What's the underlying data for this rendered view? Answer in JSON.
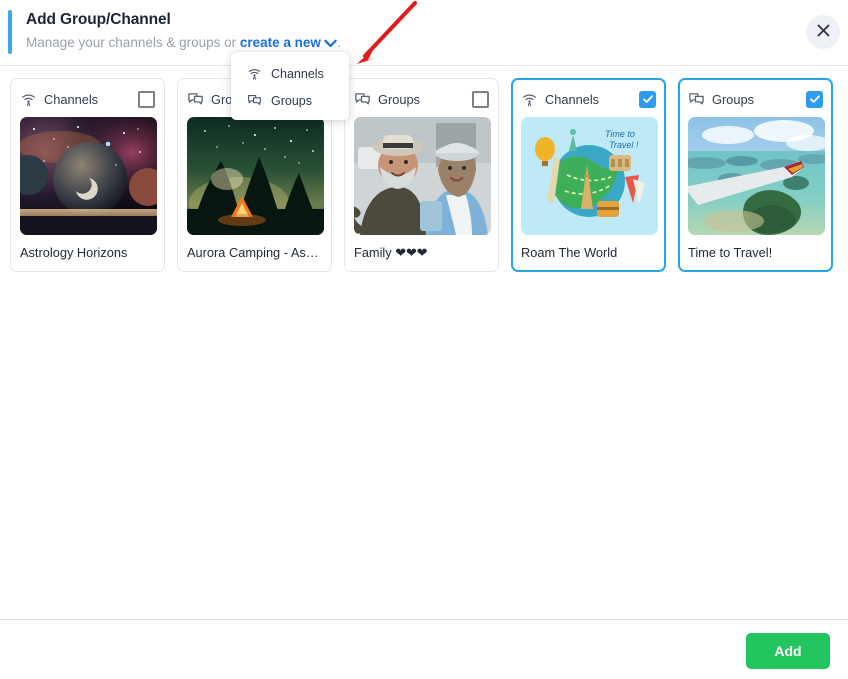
{
  "header": {
    "title": "Add Group/Channel",
    "subtitle_prefix": "Manage your channels & groups or ",
    "create_link": "create a new",
    "subtitle_suffix": ".",
    "close_icon": "close-icon",
    "accent_color": "#3ba7e8"
  },
  "dropdown": {
    "items": [
      {
        "label": "Channels",
        "icon": "broadcast-icon"
      },
      {
        "label": "Groups",
        "icon": "chat-bubbles-icon"
      }
    ]
  },
  "annotation": {
    "type": "arrow",
    "color": "#e01b1b"
  },
  "cards": [
    {
      "type_label": "Channels",
      "type_icon": "broadcast-icon",
      "name": "Astrology Horizons",
      "selected": false,
      "thumb": "space-planets-nebula"
    },
    {
      "type_label": "Groups",
      "type_icon": "chat-bubbles-icon",
      "name": "Aurora Camping - As…",
      "selected": false,
      "thumb": "night-camping-tent"
    },
    {
      "type_label": "Groups",
      "type_icon": "chat-bubbles-icon",
      "name": "Family ❤❤❤",
      "selected": false,
      "thumb": "couple-selfie-street"
    },
    {
      "type_label": "Channels",
      "type_icon": "broadcast-icon",
      "name": "Roam The World",
      "selected": true,
      "thumb": "globe-travel-illustration"
    },
    {
      "type_label": "Groups",
      "type_icon": "chat-bubbles-icon",
      "name": "Time to Travel!",
      "selected": true,
      "thumb": "airplane-wing-islands"
    }
  ],
  "footer": {
    "add_label": "Add",
    "add_color": "#22c55e"
  },
  "colors": {
    "accent_blue": "#27a6e6",
    "link_blue": "#1a6fe0",
    "checkbox_blue": "#2d9cec",
    "green": "#22c55e",
    "annotation_red": "#e01b1b"
  }
}
